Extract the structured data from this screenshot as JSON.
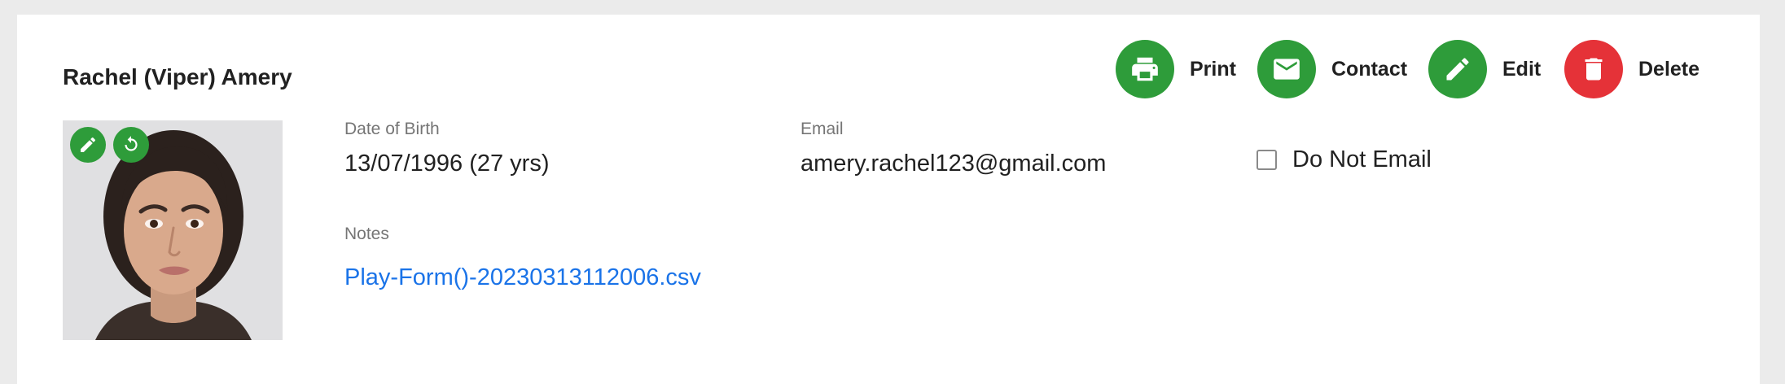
{
  "person": {
    "name": "Rachel (Viper) Amery"
  },
  "actions": {
    "print": "Print",
    "contact": "Contact",
    "edit": "Edit",
    "delete": "Delete"
  },
  "fields": {
    "dob": {
      "label": "Date of Birth",
      "value": "13/07/1996 (27 yrs)"
    },
    "email": {
      "label": "Email",
      "value": "amery.rachel123@gmail.com"
    },
    "notes": {
      "label": "Notes",
      "link": "Play-Form()-20230313112006.csv"
    }
  },
  "do_not_email": {
    "label": "Do Not Email",
    "checked": false
  },
  "icons": {
    "photo_edit": "pencil-icon",
    "photo_rotate": "rotate-icon",
    "print": "printer-icon",
    "contact": "envelope-icon",
    "edit": "pencil-icon",
    "delete": "trash-icon"
  },
  "colors": {
    "accent_green": "#2e9c3a",
    "danger_red": "#e53238",
    "link_blue": "#1a73e8",
    "page_bg": "#ebebeb"
  }
}
